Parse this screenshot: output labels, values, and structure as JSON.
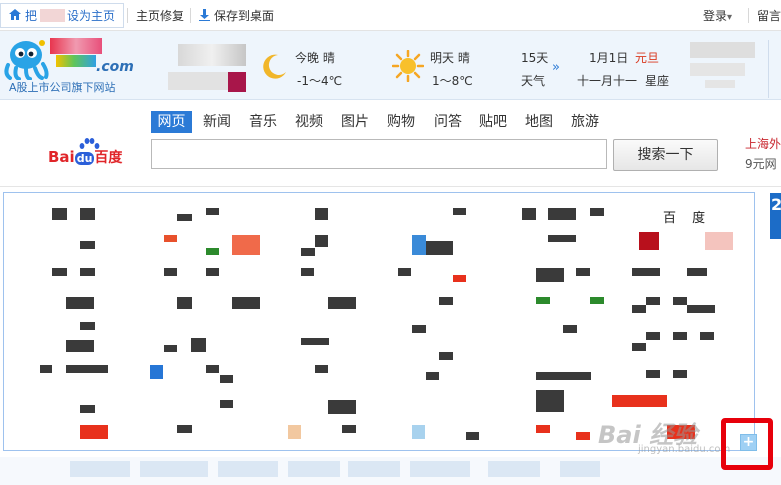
{
  "topbar": {
    "set_home_prefix": "把",
    "set_home_label": "设为主页",
    "repair_label": "主页修复",
    "save_desktop_label": "保存到桌面",
    "login_label": "登录",
    "login_arrow": "▾",
    "message_label": "留言"
  },
  "header": {
    "logo_text": ".com",
    "logo_subtitle": "A股上市公司旗下网站",
    "weather": {
      "tonight_label": "今晚 晴",
      "tonight_temp": "-1～4℃",
      "tomorrow_label": "明天 晴",
      "tomorrow_temp": "1～8℃",
      "days_15": "15天",
      "days_15_sub": "天气",
      "arrow": "»",
      "date": "1月1日",
      "holiday": "元旦",
      "lunar": "十一月十一",
      "weekday_prefix": "星座"
    }
  },
  "search": {
    "logo_left": "Bai",
    "logo_paw": "du",
    "logo_right": "百度",
    "tabs": [
      "网页",
      "新闻",
      "音乐",
      "视频",
      "图片",
      "购物",
      "问答",
      "贴吧",
      "地图",
      "旅游"
    ],
    "active_tab": 0,
    "input_value": "",
    "button_label": "搜索一下",
    "promo_line1": "上海外",
    "promo_line2": "9元网"
  },
  "panel": {
    "top_right_site": "百  度",
    "badge_number": "2"
  },
  "watermark": {
    "text": "Bai 经验",
    "sub": "jingyan.baidu.com"
  },
  "add_button": {
    "label": "+"
  },
  "colors": {
    "accent_blue": "#2b7ad6",
    "panel_border": "#9ec2ee",
    "highlight_red": "#e7000b",
    "logo_blue": "#2d6fb6"
  }
}
